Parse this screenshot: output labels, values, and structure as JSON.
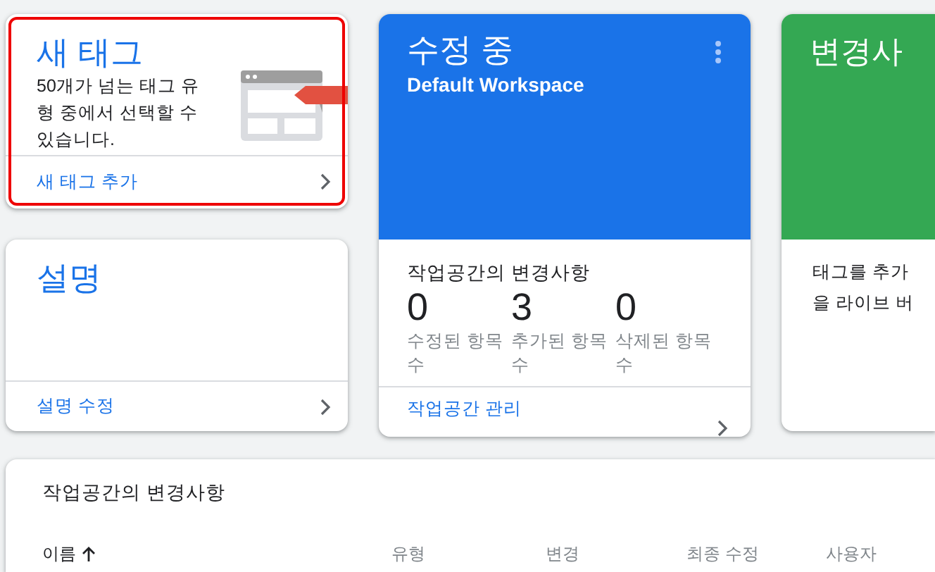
{
  "new_tag_card": {
    "highlighted": true,
    "title": "새 태그",
    "description": "50개가 넘는 태그 유형 중에서 선택할 수 있습니다.",
    "link": "새 태그 추가"
  },
  "description_card": {
    "title": "설명",
    "link": "설명 수정"
  },
  "workspace_card": {
    "title": "수정 중",
    "subtitle": "Default Workspace",
    "section_title": "작업공간의 변경사항",
    "stats": [
      {
        "value": "0",
        "label": "수정된 항목 수"
      },
      {
        "value": "3",
        "label": "추가된 항목 수"
      },
      {
        "value": "0",
        "label": "삭제된 항목 수"
      }
    ],
    "link": "작업공간 관리"
  },
  "changes_card": {
    "title": "변경사",
    "lines": [
      "태그를 추가",
      "을 라이브 버"
    ]
  },
  "table": {
    "title": "작업공간의 변경사항",
    "columns": [
      {
        "label": "이름",
        "sorted": true
      },
      {
        "label": "유형",
        "sorted": false
      },
      {
        "label": "변경",
        "sorted": false
      },
      {
        "label": "최종 수정",
        "sorted": false
      },
      {
        "label": "사용자",
        "sorted": false
      }
    ]
  }
}
